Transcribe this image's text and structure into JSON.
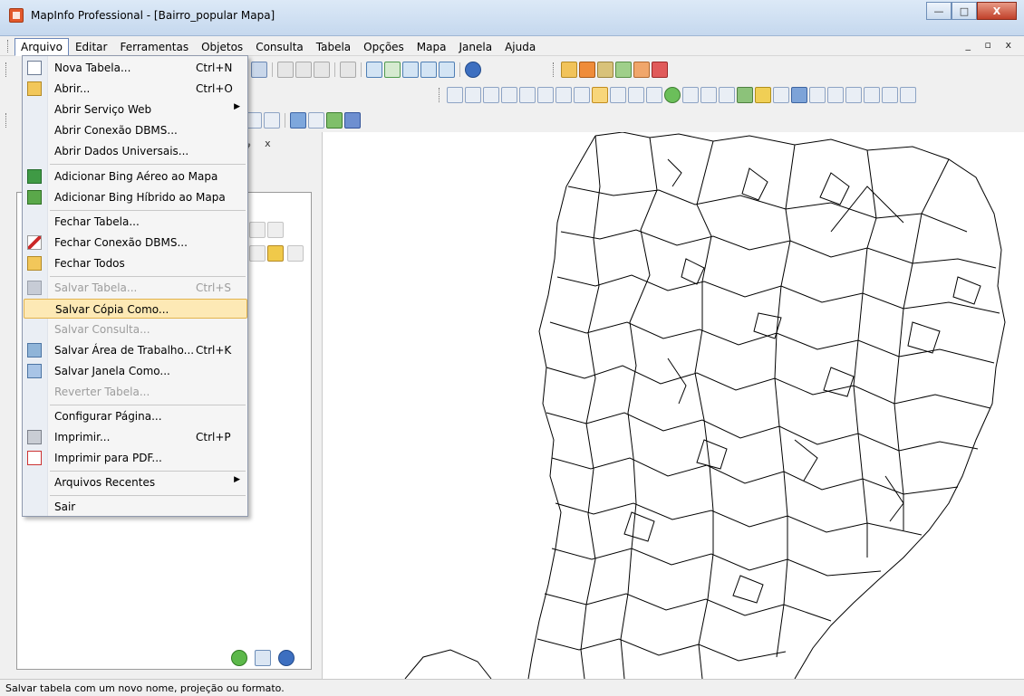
{
  "window": {
    "title": "MapInfo Professional - [Bairro_popular Mapa]",
    "minimize": "—",
    "maximize": "□",
    "close": "X",
    "mdi_controls": "_ ▫ x"
  },
  "menubar": {
    "items": [
      "Arquivo",
      "Editar",
      "Ferramentas",
      "Objetos",
      "Consulta",
      "Tabela",
      "Opções",
      "Mapa",
      "Janela",
      "Ajuda"
    ]
  },
  "file_menu": {
    "items": [
      {
        "label": "Nova Tabela...",
        "shortcut": "Ctrl+N",
        "icon": "new-table-icon"
      },
      {
        "label": "Abrir...",
        "shortcut": "Ctrl+O",
        "icon": "open-folder-icon"
      },
      {
        "label": "Abrir Serviço Web",
        "shortcut": "",
        "icon": "",
        "submenu": "▶"
      },
      {
        "label": "Abrir Conexão DBMS...",
        "shortcut": "",
        "icon": ""
      },
      {
        "label": "Abrir Dados Universais...",
        "shortcut": "",
        "icon": ""
      },
      {
        "label": "Adicionar Bing Aéreo ao Mapa",
        "shortcut": "",
        "icon": "bing-aerial-icon"
      },
      {
        "label": "Adicionar Bing Híbrido ao Mapa",
        "shortcut": "",
        "icon": "bing-hybrid-icon"
      },
      {
        "label": "Fechar Tabela...",
        "shortcut": "",
        "icon": ""
      },
      {
        "label": "Fechar Conexão DBMS...",
        "shortcut": "",
        "icon": "close-dbms-icon"
      },
      {
        "label": "Fechar Todos",
        "shortcut": "",
        "icon": "close-all-icon"
      },
      {
        "label": "Salvar Tabela...",
        "shortcut": "Ctrl+S",
        "icon": "save-icon"
      },
      {
        "label": "Salvar Cópia Como...",
        "shortcut": "",
        "icon": ""
      },
      {
        "label": "Salvar Consulta...",
        "shortcut": "",
        "icon": ""
      },
      {
        "label": "Salvar Área de Trabalho...",
        "shortcut": "Ctrl+K",
        "icon": "save-workspace-icon"
      },
      {
        "label": "Salvar Janela Como...",
        "shortcut": "",
        "icon": "save-window-icon"
      },
      {
        "label": "Reverter Tabela...",
        "shortcut": "",
        "icon": ""
      },
      {
        "label": "Configurar Página...",
        "shortcut": "",
        "icon": ""
      },
      {
        "label": "Imprimir...",
        "shortcut": "Ctrl+P",
        "icon": "printer-icon"
      },
      {
        "label": "Imprimir para PDF...",
        "shortcut": "",
        "icon": "pdf-icon"
      },
      {
        "label": "Arquivos Recentes",
        "shortcut": "",
        "icon": "",
        "submenu": "▶"
      },
      {
        "label": "Sair",
        "shortcut": "",
        "icon": ""
      }
    ]
  },
  "layer_panel": {
    "header_controls": "ᵩ x"
  },
  "status": {
    "text": "Salvar tabela com um novo nome, projeção ou formato."
  }
}
